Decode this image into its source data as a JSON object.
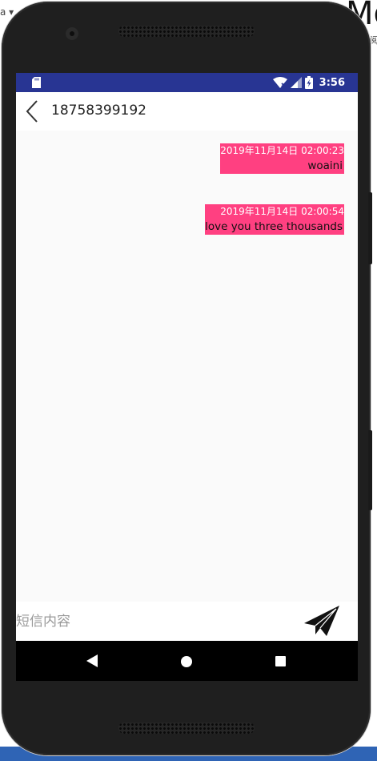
{
  "background": {
    "left_text": "a ▾",
    "right_text": "Mo",
    "right_small": "阅"
  },
  "status_bar": {
    "time": "3:56",
    "icons": [
      "sd-card-icon",
      "wifi-icon",
      "signal-icon",
      "battery-charging-icon"
    ],
    "color": "#283593"
  },
  "toolbar": {
    "back_icon": "chevron-left-icon",
    "title": "18758399192"
  },
  "messages": [
    {
      "time": "2019年11月14日 02:00:23",
      "body": "woaini"
    },
    {
      "time": "2019年11月14日 02:00:54",
      "body": "love you three thousands"
    }
  ],
  "bubble_color": "#ff4081",
  "compose": {
    "placeholder": "短信内容",
    "value": "",
    "send_icon": "paper-plane-icon"
  },
  "nav_bar": {
    "icons": [
      "back-triangle-icon",
      "home-circle-icon",
      "recents-square-icon"
    ]
  }
}
